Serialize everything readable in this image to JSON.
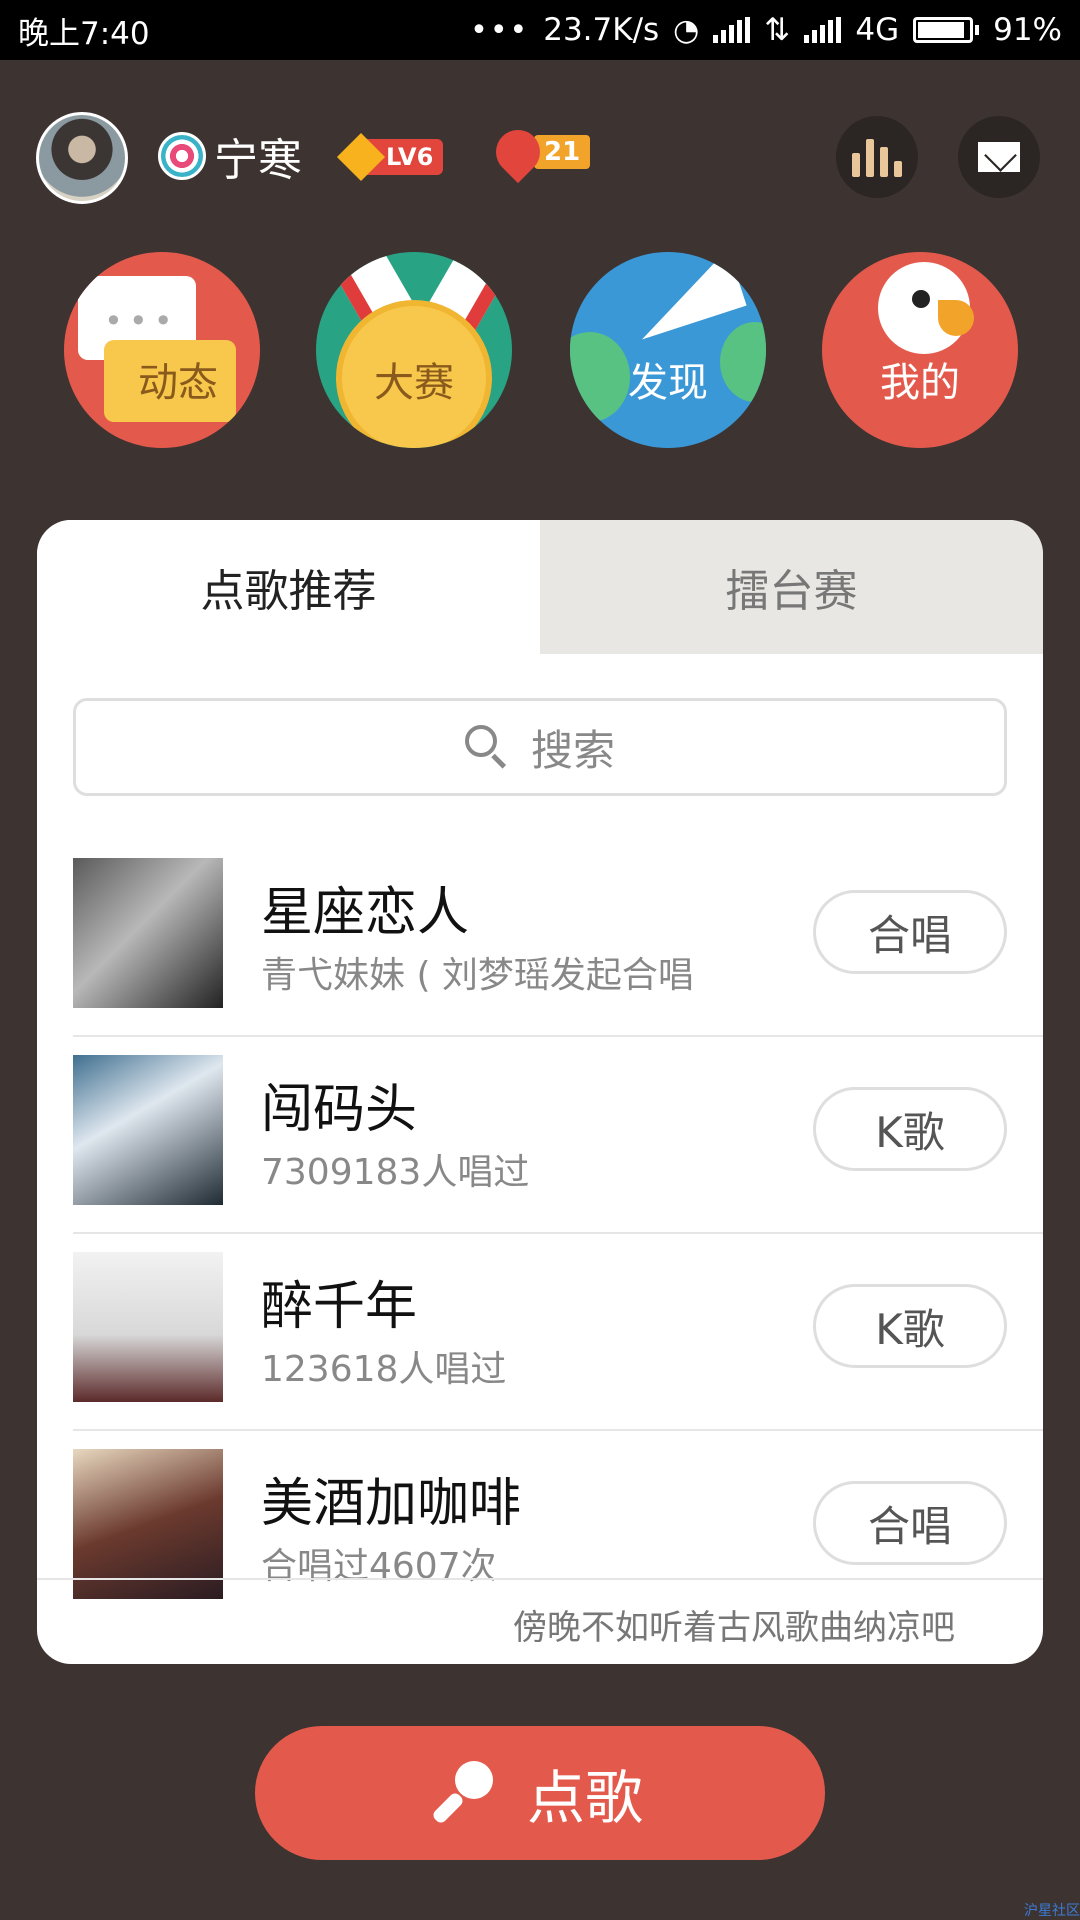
{
  "status_bar": {
    "time": "晚上7:40",
    "dots": "•••",
    "speed": "23.7K/s",
    "network": "4G",
    "battery": "91%",
    "battery_level": 0.91
  },
  "user": {
    "name": "宁寒",
    "level": "LV6",
    "flowers": "21"
  },
  "nav": {
    "dynamic": "动态",
    "contest": "大赛",
    "discover": "发现",
    "mine": "我的"
  },
  "tabs": {
    "recommend": "点歌推荐",
    "arena": "擂台赛"
  },
  "search": {
    "placeholder": "搜索"
  },
  "songs": [
    {
      "title": "星座恋人",
      "subtitle": "青弋妹妹 ( 刘梦瑶发起合唱",
      "action": "合唱"
    },
    {
      "title": "闯码头",
      "subtitle": "7309183人唱过",
      "action": "K歌"
    },
    {
      "title": "醉千年",
      "subtitle": "123618人唱过",
      "action": "K歌"
    },
    {
      "title": "美酒加咖啡",
      "subtitle": "合唱过4607次",
      "action": "合唱"
    }
  ],
  "footer_tip": "傍晚不如听着古风歌曲纳凉吧",
  "sing_button": "点歌",
  "watermark": "沪星社区",
  "colors": {
    "background": "#3d3432",
    "accent": "#e35a4c",
    "tab_inactive": "#e8e7e3"
  },
  "icons": {
    "stats": "bar-chart-icon",
    "mail": "mail-icon",
    "search": "search-icon",
    "mic": "microphone-icon"
  }
}
